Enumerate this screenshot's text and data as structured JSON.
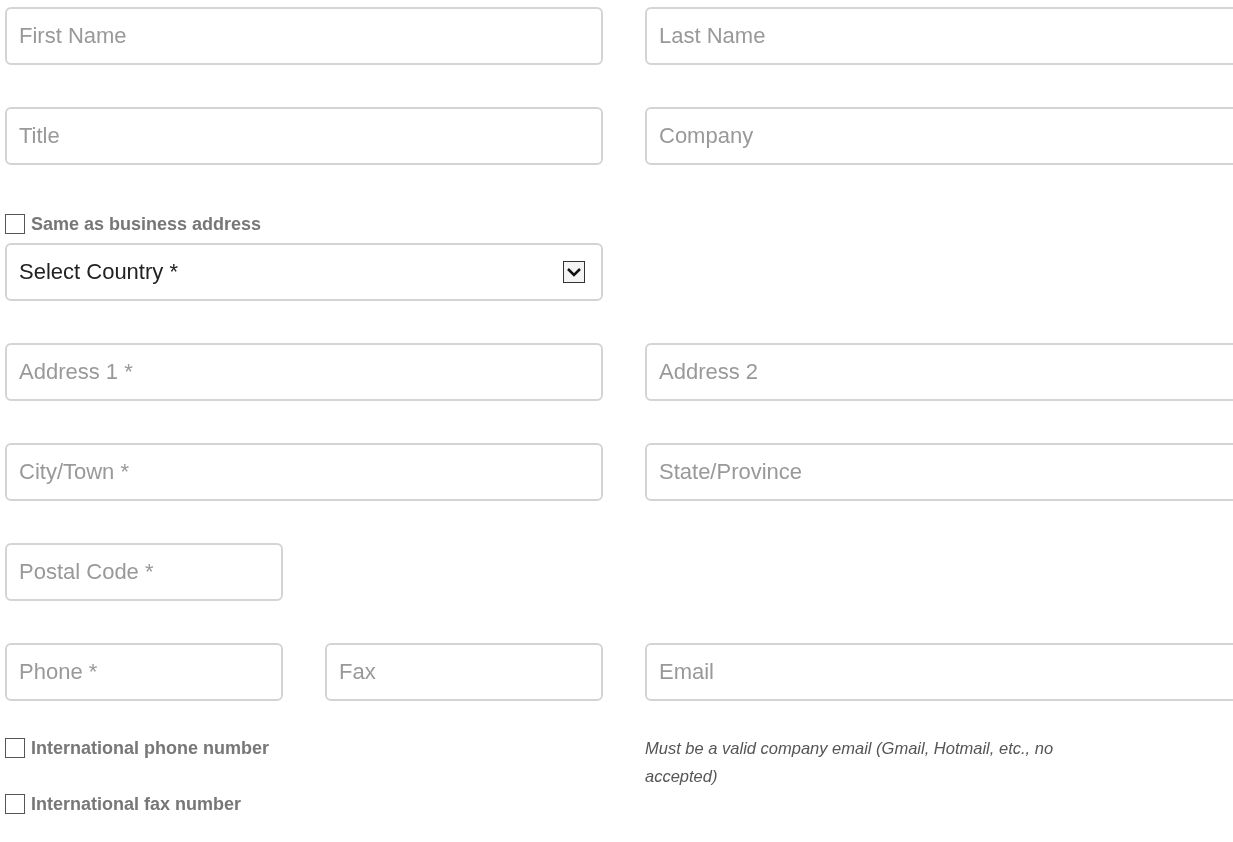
{
  "first_name": {
    "placeholder": "First Name"
  },
  "last_name": {
    "placeholder": "Last Name"
  },
  "title": {
    "placeholder": "Title"
  },
  "company": {
    "placeholder": "Company"
  },
  "same_as_business": {
    "label": "Same as business address",
    "checked": false
  },
  "country": {
    "value": "Select Country *"
  },
  "address_1": {
    "placeholder": "Address 1 *"
  },
  "address_2": {
    "placeholder": "Address 2"
  },
  "city": {
    "placeholder": "City/Town *"
  },
  "state": {
    "placeholder": "State/Province"
  },
  "postal_code": {
    "placeholder": "Postal Code *"
  },
  "phone": {
    "placeholder": "Phone *"
  },
  "fax": {
    "placeholder": "Fax"
  },
  "email": {
    "placeholder": "Email"
  },
  "international_phone": {
    "label": "International phone number",
    "checked": false
  },
  "email_note": [
    "Must be a valid company email (Gmail, Hotmail, etc., no",
    "accepted)"
  ],
  "international_fax": {
    "label": "International fax number",
    "checked": false
  }
}
